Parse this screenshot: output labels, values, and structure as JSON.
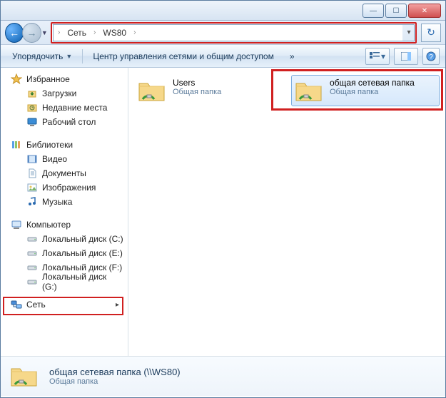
{
  "titlebar": {
    "min": "—",
    "max": "☐",
    "close": "✕"
  },
  "nav": {
    "back": "←",
    "forward": "→",
    "dropdown": "▼",
    "breadcrumb": [
      "Сеть",
      "WS80"
    ],
    "sep": "›",
    "addr_drop": "▾",
    "refresh": "↻"
  },
  "toolbar": {
    "organize": "Упорядочить",
    "organize_dd": "▼",
    "network_center": "Центр управления сетями и общим доступом",
    "overflow": "»",
    "view_dd": "▾",
    "help": "?"
  },
  "sidebar": {
    "favorites": {
      "label": "Избранное",
      "items": [
        {
          "label": "Загрузки",
          "icon": "dl"
        },
        {
          "label": "Недавние места",
          "icon": "recent"
        },
        {
          "label": "Рабочий стол",
          "icon": "desk"
        }
      ]
    },
    "libraries": {
      "label": "Библиотеки",
      "items": [
        {
          "label": "Видео",
          "icon": "vid"
        },
        {
          "label": "Документы",
          "icon": "doc"
        },
        {
          "label": "Изображения",
          "icon": "img"
        },
        {
          "label": "Музыка",
          "icon": "mus"
        }
      ]
    },
    "computer": {
      "label": "Компьютер",
      "items": [
        {
          "label": "Локальный диск (C:)"
        },
        {
          "label": "Локальный диск (E:)"
        },
        {
          "label": "Локальный диск (F:)"
        },
        {
          "label": "Локальный диск (G:)"
        }
      ]
    },
    "network": {
      "label": "Сеть"
    }
  },
  "content": {
    "items": [
      {
        "title": "Users",
        "sub": "Общая папка",
        "selected": false
      },
      {
        "title": "общая сетевая папка",
        "sub": "Общая папка",
        "selected": true
      }
    ]
  },
  "details": {
    "title": "общая сетевая папка (\\\\WS80)",
    "sub": "Общая папка"
  }
}
